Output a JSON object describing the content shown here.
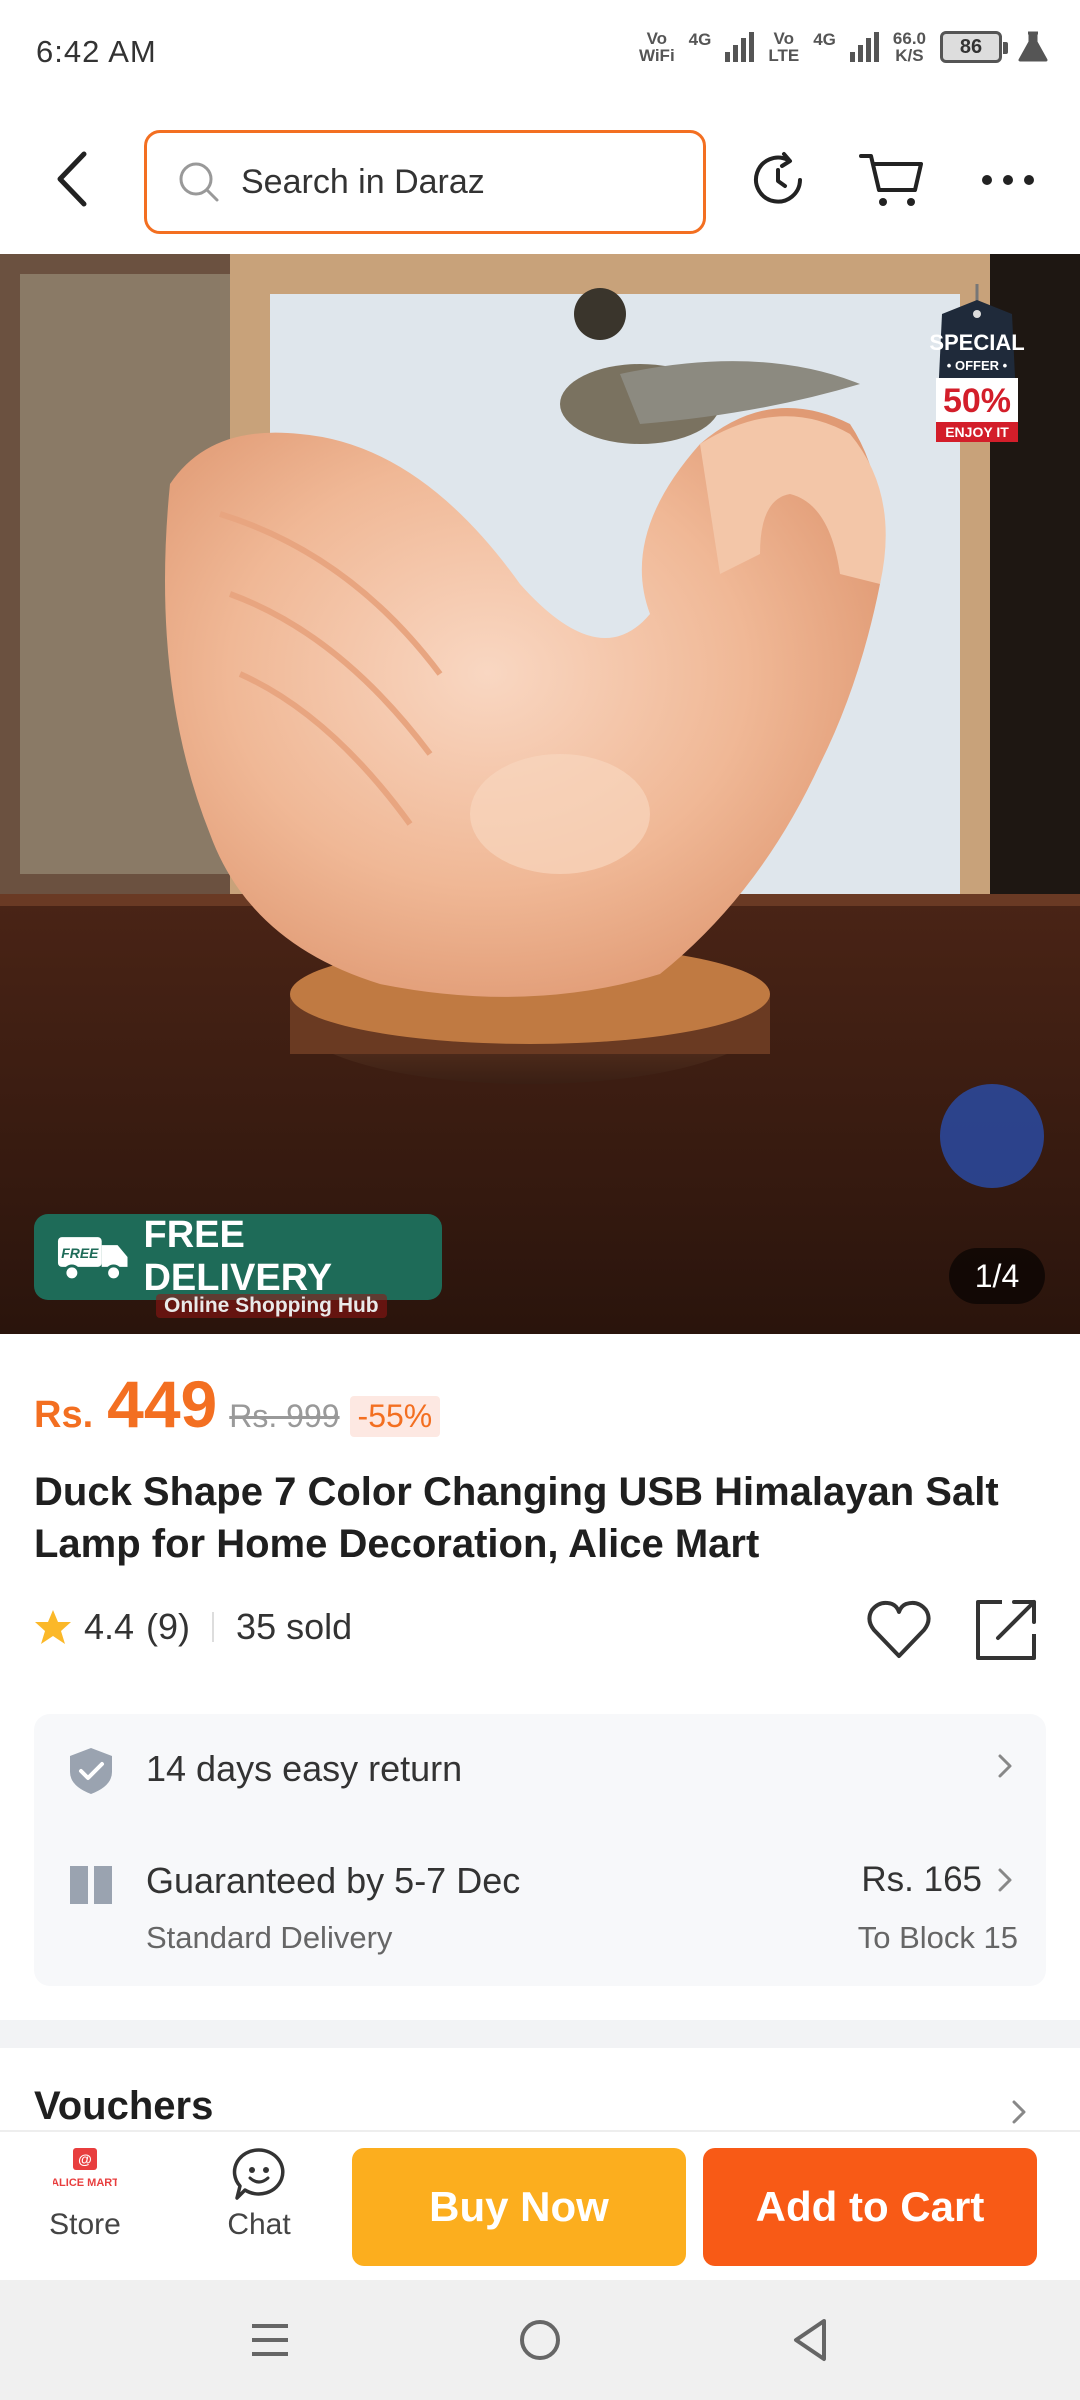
{
  "status_bar": {
    "time": "6:42 AM",
    "wifi_label_top": "Vo",
    "wifi_label_bottom": "WiFi",
    "sim1_net": "4G",
    "lte_label_top": "Vo",
    "lte_label_bottom": "LTE",
    "sim2_net": "4G",
    "speed_value": "66.0",
    "speed_unit": "K/S",
    "battery": "86"
  },
  "search": {
    "placeholder": "Search in Daraz",
    "border_color": "#f36f21"
  },
  "icons": {
    "back": "back-arrow-icon",
    "search": "search-icon",
    "history": "history-icon",
    "cart": "cart-icon",
    "more": "more-icon"
  },
  "product_image": {
    "tag_line1": "SPECIAL",
    "tag_line2": "• OFFER •",
    "tag_line3": "50%",
    "tag_line4": "ENJOY IT",
    "free_badge": "FREE",
    "free_delivery": "FREE DELIVERY",
    "shop_hub": "Online Shopping Hub",
    "counter": "1/4"
  },
  "price": {
    "currency": "Rs.",
    "value": "449",
    "original": "Rs. 999",
    "discount": "-55%",
    "color": "#f36f21"
  },
  "product": {
    "title": "Duck Shape 7 Color Changing USB Himalayan Salt Lamp for Home Decoration, Alice Mart"
  },
  "rating": {
    "score": "4.4",
    "count": "(9)",
    "sold": "35 sold",
    "stars": 4.4
  },
  "service": {
    "return_text": "14 days easy return",
    "delivery_title": "Guaranteed by 5-7 Dec",
    "delivery_sub": "Standard Delivery",
    "delivery_price": "Rs. 165",
    "delivery_location": "To Block 15"
  },
  "vouchers": {
    "title": "Vouchers"
  },
  "action_bar": {
    "store_label": "Store",
    "store_logo_text": "ALICE MART",
    "chat_label": "Chat",
    "buy_now": "Buy Now",
    "add_to_cart": "Add to Cart",
    "buy_color": "#fcae1e",
    "cart_color": "#f85a16"
  }
}
